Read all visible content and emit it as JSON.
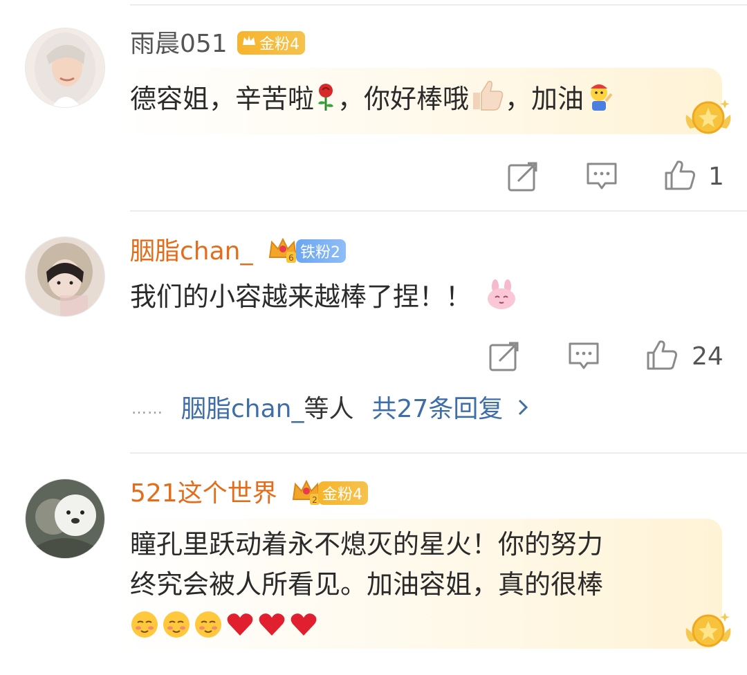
{
  "comments": [
    {
      "username": "雨晨051",
      "badge": {
        "type": "gold",
        "label": "金粉4"
      },
      "segments": [
        "德容姐，辛苦啦",
        "，你好棒哦",
        "，加油"
      ],
      "emojis": [
        "rose-emoji",
        "thumbs-up-emoji",
        "cheering-emoji"
      ],
      "likes": "1"
    },
    {
      "username": "胭脂chan_",
      "badge": {
        "type": "iron",
        "label": "铁粉2"
      },
      "level_icon": "crown-6-icon",
      "text": "我们的小容越来越棒了捏！！",
      "emojis": [
        "pink-bunny-emoji"
      ],
      "likes": "24",
      "replies": {
        "dots": "……",
        "who": "胭脂chan_",
        "suffix": "等人",
        "total": "共27条回复"
      }
    },
    {
      "username": "521这个世界",
      "badge": {
        "type": "gold",
        "label": "金粉4"
      },
      "level_icon": "crown-2-icon",
      "line1": "瞳孔里跃动着永不熄灭的星火！你的努力",
      "line2": "终究会被人所看见。加油容姐，真的很棒",
      "emojis": [
        "shy-face-emoji",
        "shy-face-emoji",
        "shy-face-emoji",
        "red-heart-emoji",
        "red-heart-emoji",
        "red-heart-emoji"
      ]
    }
  ],
  "colors": {
    "username_orange": "#e36d1a",
    "link_blue": "#3d6ea8",
    "gold_badge": "#f7b42c",
    "iron_badge": "#6aa6f2"
  }
}
